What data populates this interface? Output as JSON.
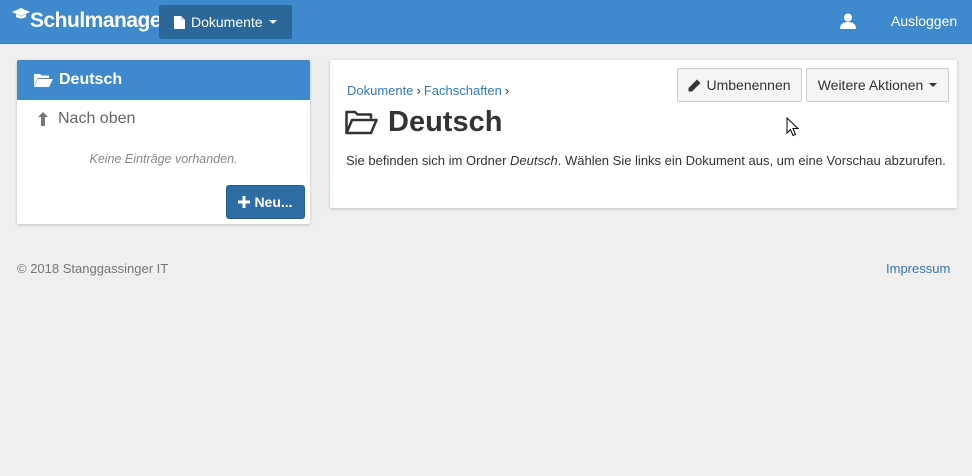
{
  "navbar": {
    "brand": "Schulmanager",
    "documents_menu": "Dokumente",
    "logout": "Ausloggen"
  },
  "sidebar": {
    "folder_title": "Deutsch",
    "up_label": "Nach oben",
    "empty_message": "Keine Einträge vorhanden.",
    "new_button": "Neu..."
  },
  "main": {
    "breadcrumb": [
      {
        "label": "Dokumente"
      },
      {
        "label": "Fachschaften"
      }
    ],
    "rename_button": "Umbenennen",
    "more_actions_button": "Weitere Aktionen",
    "title": "Deutsch",
    "description_prefix": "Sie befinden sich im Ordner ",
    "description_folder": "Deutsch",
    "description_suffix": ". Wählen Sie links ein Dokument aus, um eine Vorschau abzurufen."
  },
  "footer": {
    "copyright": "© 2018 Stanggassinger IT",
    "impressum": "Impressum"
  },
  "colors": {
    "primary": "#3e8acc",
    "primary_dark": "#2b6799",
    "button_primary": "#2e6da4",
    "link": "#337ab7",
    "background": "#efefef"
  }
}
